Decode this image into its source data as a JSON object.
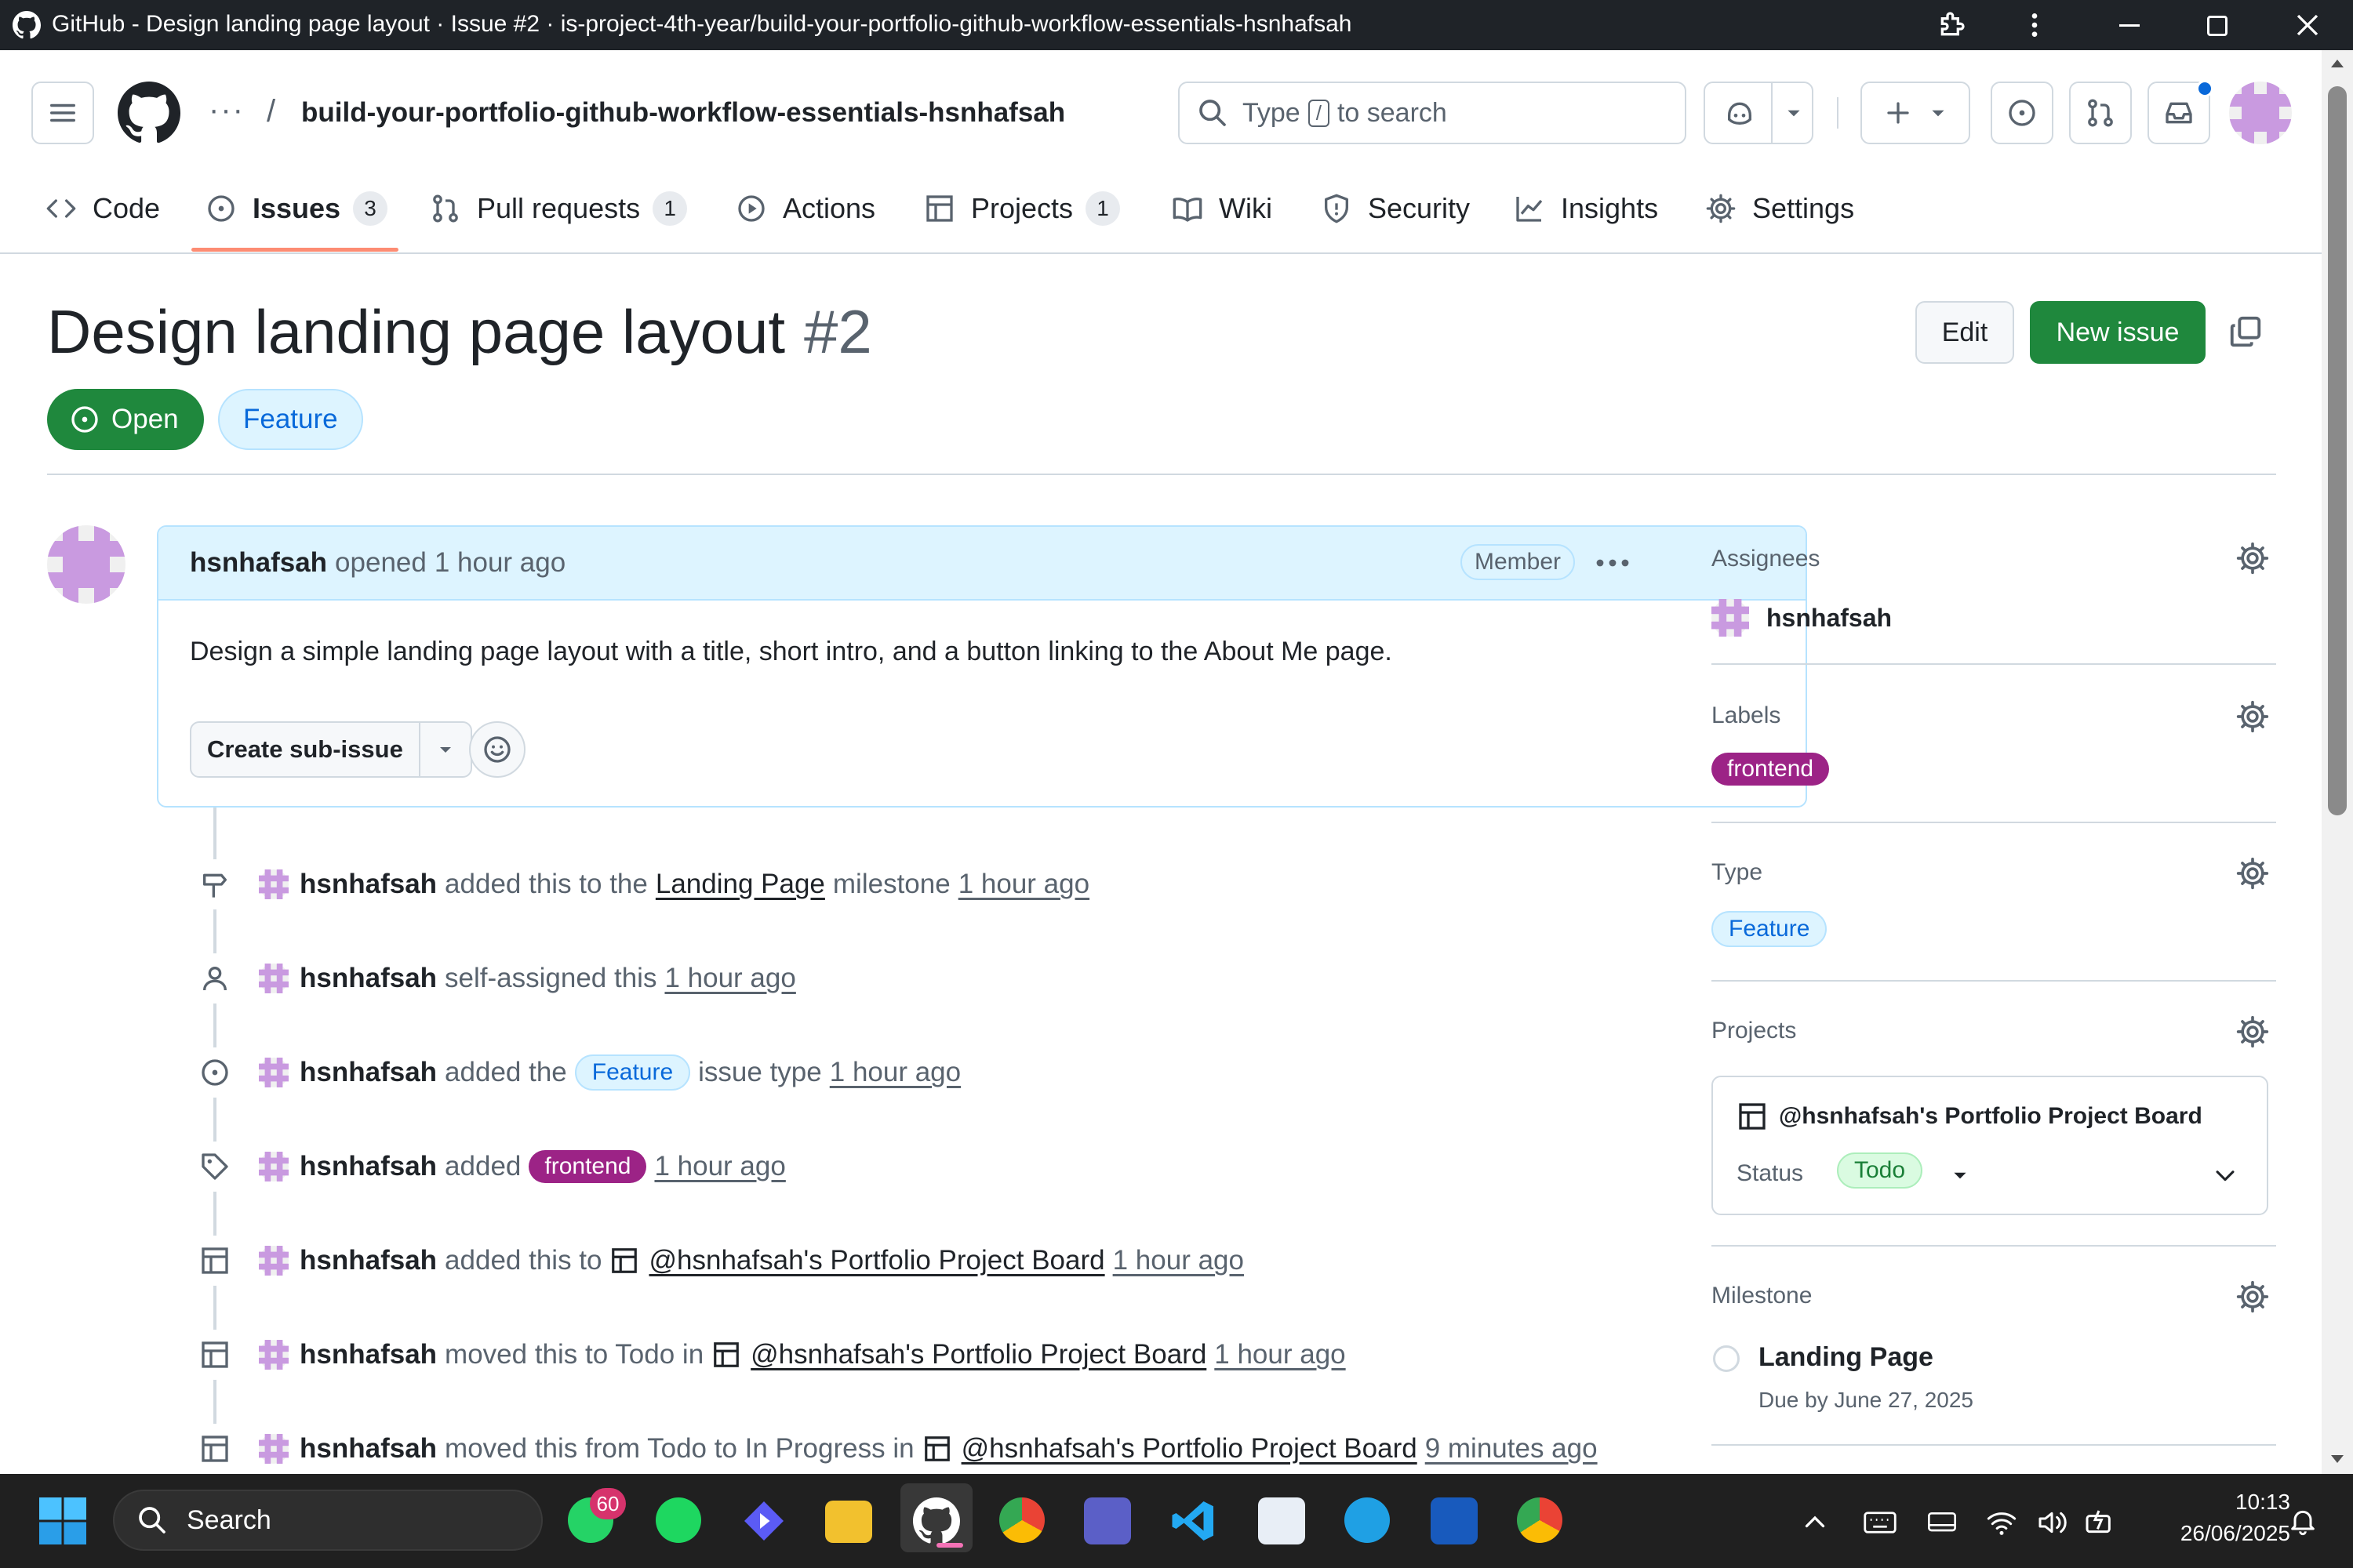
{
  "window": {
    "title": "GitHub - Design landing page layout · Issue #2 · is-project-4th-year/build-your-portfolio-github-workflow-essentials-hsnhafsah"
  },
  "header": {
    "dots": "···",
    "separator": "/",
    "repo_name": "build-your-portfolio-github-workflow-essentials-hsnhafsah",
    "search_prefix": "Type",
    "search_key": "/",
    "search_suffix": "to search"
  },
  "tabs": [
    {
      "label": "Code",
      "icon": "code-icon"
    },
    {
      "label": "Issues",
      "icon": "issue-opened-icon",
      "count": "3",
      "selected": true
    },
    {
      "label": "Pull requests",
      "icon": "git-pull-request-icon",
      "count": "1"
    },
    {
      "label": "Actions",
      "icon": "play-icon"
    },
    {
      "label": "Projects",
      "icon": "table-icon",
      "count": "1"
    },
    {
      "label": "Wiki",
      "icon": "book-icon"
    },
    {
      "label": "Security",
      "icon": "shield-icon"
    },
    {
      "label": "Insights",
      "icon": "graph-icon"
    },
    {
      "label": "Settings",
      "icon": "gear-icon"
    }
  ],
  "issue": {
    "title": "Design landing page layout",
    "number": "#2",
    "edit_label": "Edit",
    "new_issue_label": "New issue",
    "state": "Open",
    "type_badge": "Feature",
    "colors": {
      "open_green": "#1f883d",
      "feature_blue": "#0969da",
      "frontend_purple": "#9c2386"
    }
  },
  "comment": {
    "author": "hsnhafsah",
    "action": "opened",
    "time": "1 hour ago",
    "role": "Member",
    "body": "Design a simple landing page layout with a title, short intro, and a button linking to the About Me page.",
    "sub_issue_label": "Create sub-issue"
  },
  "timeline": [
    {
      "icon": "milestone-icon",
      "user": "hsnhafsah",
      "pre": "added this to the",
      "link": "Landing Page",
      "post": "milestone",
      "time": "1 hour ago"
    },
    {
      "icon": "person-icon",
      "user": "hsnhafsah",
      "pre": "self-assigned this",
      "time": "1 hour ago"
    },
    {
      "icon": "issue-opened-icon",
      "user": "hsnhafsah",
      "pre": "added the",
      "badge": "Feature",
      "post": "issue type",
      "time": "1 hour ago"
    },
    {
      "icon": "tag-icon",
      "user": "hsnhafsah",
      "pre": "added",
      "label": "frontend",
      "time": "1 hour ago"
    },
    {
      "icon": "table-icon",
      "user": "hsnhafsah",
      "pre": "added this to",
      "project": "@hsnhafsah's Portfolio Project Board",
      "time": "1 hour ago"
    },
    {
      "icon": "table-icon",
      "user": "hsnhafsah",
      "pre": "moved this to Todo in",
      "project": "@hsnhafsah's Portfolio Project Board",
      "time": "1 hour ago"
    },
    {
      "icon": "table-icon",
      "user": "hsnhafsah",
      "pre": "moved this from Todo to In Progress in",
      "project": "@hsnhafsah's Portfolio Project Board",
      "time": "9 minutes ago"
    }
  ],
  "sidebar": {
    "assignees": {
      "heading": "Assignees",
      "name": "hsnhafsah"
    },
    "labels": {
      "heading": "Labels",
      "label": "frontend"
    },
    "type": {
      "heading": "Type",
      "value": "Feature"
    },
    "projects": {
      "heading": "Projects",
      "board": "@hsnhafsah's Portfolio Project Board",
      "status_label": "Status",
      "status_value": "Todo"
    },
    "milestone": {
      "heading": "Milestone",
      "name": "Landing Page",
      "due": "Due by June 27, 2025"
    }
  },
  "taskbar": {
    "search_placeholder": "Search",
    "whatsapp_badge": "60",
    "time": "10:13",
    "date": "26/06/2025"
  }
}
